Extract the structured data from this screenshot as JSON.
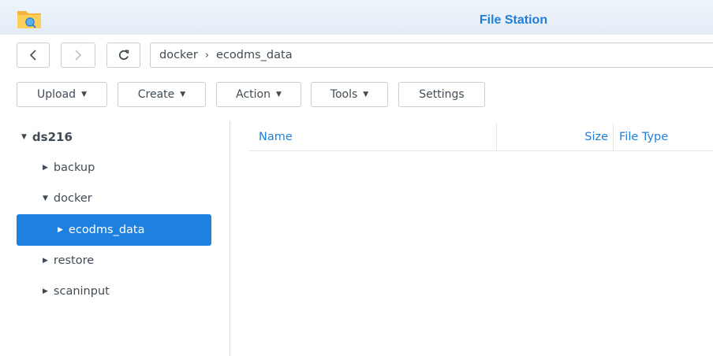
{
  "window": {
    "title": "File Station"
  },
  "nav": {
    "path": [
      "docker",
      "ecodms_data"
    ],
    "path_separator": "›"
  },
  "toolbar": {
    "upload_label": "Upload",
    "create_label": "Create",
    "action_label": "Action",
    "tools_label": "Tools",
    "settings_label": "Settings"
  },
  "tree": {
    "root": "ds216",
    "items": [
      {
        "label": "backup",
        "state": "collapsed"
      },
      {
        "label": "docker",
        "state": "expanded"
      },
      {
        "label": "ecodms_data",
        "state": "collapsed",
        "selected": true
      },
      {
        "label": "restore",
        "state": "collapsed"
      },
      {
        "label": "scaninput",
        "state": "collapsed"
      }
    ]
  },
  "grid": {
    "columns": [
      "Name",
      "Size",
      "File Type"
    ]
  },
  "colors": {
    "accent": "#1f7fdb",
    "selection": "#1e81e0",
    "titlebar": "#e6eef7"
  }
}
